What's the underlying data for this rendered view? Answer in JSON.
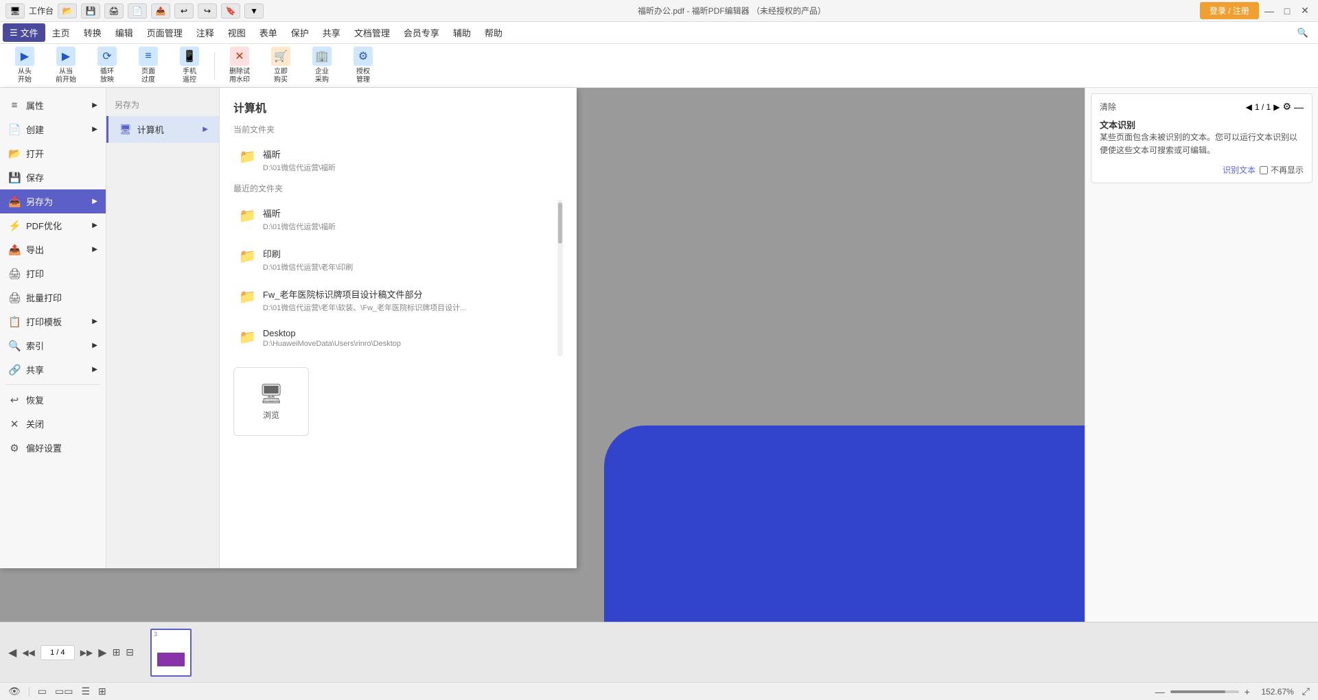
{
  "titlebar": {
    "title": "福昕办公.pdf - 福昕PDF编辑器 （未经授权的产品）",
    "login_btn": "登录 / 注册",
    "workbench_label": "工作台"
  },
  "menubar": {
    "items": [
      {
        "label": "文件",
        "active": true
      },
      {
        "label": "主页"
      },
      {
        "label": "转换"
      },
      {
        "label": "编辑"
      },
      {
        "label": "页面管理"
      },
      {
        "label": "注释"
      },
      {
        "label": "视图"
      },
      {
        "label": "表单"
      },
      {
        "label": "保护"
      },
      {
        "label": "共享"
      },
      {
        "label": "文档管理"
      },
      {
        "label": "会员专享"
      },
      {
        "label": "辅助"
      },
      {
        "label": "帮助"
      }
    ]
  },
  "toolbar": {
    "items": [
      {
        "icon": "▶",
        "label": "从头\n开始",
        "iconType": "blue"
      },
      {
        "icon": "▶",
        "label": "从当\n前开始",
        "iconType": "blue"
      },
      {
        "icon": "⟳",
        "label": "循环\n放映",
        "iconType": "blue"
      },
      {
        "icon": "≡",
        "label": "页面\n过度",
        "iconType": "blue"
      },
      {
        "icon": "📱",
        "label": "手机\n遥控",
        "iconType": "blue"
      },
      {
        "icon": "✕",
        "label": "删除试\n用水印",
        "iconType": "red"
      },
      {
        "icon": "🛒",
        "label": "立即\n购买",
        "iconType": "orange"
      },
      {
        "icon": "🏢",
        "label": "企业\n采购",
        "iconType": "blue"
      },
      {
        "icon": "⚙",
        "label": "授权\n管理",
        "iconType": "blue"
      }
    ]
  },
  "file_menu": {
    "title": "文件",
    "sidebar_items": [
      {
        "label": "属性",
        "icon": "≡",
        "hasArrow": true
      },
      {
        "label": "创建",
        "icon": "📄",
        "hasArrow": true
      },
      {
        "label": "打开",
        "icon": "📂"
      },
      {
        "label": "保存",
        "icon": "💾"
      },
      {
        "label": "另存为",
        "icon": "📥",
        "hasArrow": true,
        "active": true
      },
      {
        "label": "PDF优化",
        "icon": "⚡",
        "hasArrow": true
      },
      {
        "label": "导出",
        "icon": "📤",
        "hasArrow": true
      },
      {
        "label": "打印",
        "icon": "🖨"
      },
      {
        "label": "批量打印",
        "icon": "🖨"
      },
      {
        "label": "打印模板",
        "icon": "📋",
        "hasArrow": true
      },
      {
        "label": "索引",
        "icon": "🔍",
        "hasArrow": true
      },
      {
        "label": "共享",
        "icon": "🔗",
        "hasArrow": true
      },
      {
        "label": "恢复",
        "icon": "↩"
      },
      {
        "label": "关闭",
        "icon": "✕"
      },
      {
        "label": "偏好设置",
        "icon": "⚙"
      }
    ],
    "save_options": [
      {
        "label": "计算机",
        "icon": "🖥",
        "active": true
      }
    ],
    "right_panel": {
      "title": "计算机",
      "current_folder_label": "当前文件夹",
      "recent_folder_label": "最近的文件夹",
      "current_folders": [
        {
          "name": "福昕",
          "path": "D:\\01微信代运营\\福昕"
        }
      ],
      "recent_folders": [
        {
          "name": "福昕",
          "path": "D:\\01微信代运营\\福昕"
        },
        {
          "name": "印刷",
          "path": "D:\\01微信代运营\\老年\\印刷"
        },
        {
          "name": "Fw_老年医院标识牌项目设计稿文件部分",
          "path": "D:\\01微信代运营\\老年\\软装、\\Fw_老年医院标识牌项目设计..."
        },
        {
          "name": "Desktop",
          "path": "D:\\HuaweiMoveData\\Users\\rinro\\Desktop"
        }
      ],
      "browse_label": "浏览"
    }
  },
  "ocr_panel": {
    "title": "文本识别",
    "page_info": "1 / 1",
    "description": "某些页面包含未被识别的文本。您可以运行文本识别以便使这些文本可搜索或可编辑。",
    "link_label": "识别文本",
    "no_show_label": "不再显示"
  },
  "status_bar": {
    "page_info": "1 / 4",
    "zoom": "152.67%"
  }
}
